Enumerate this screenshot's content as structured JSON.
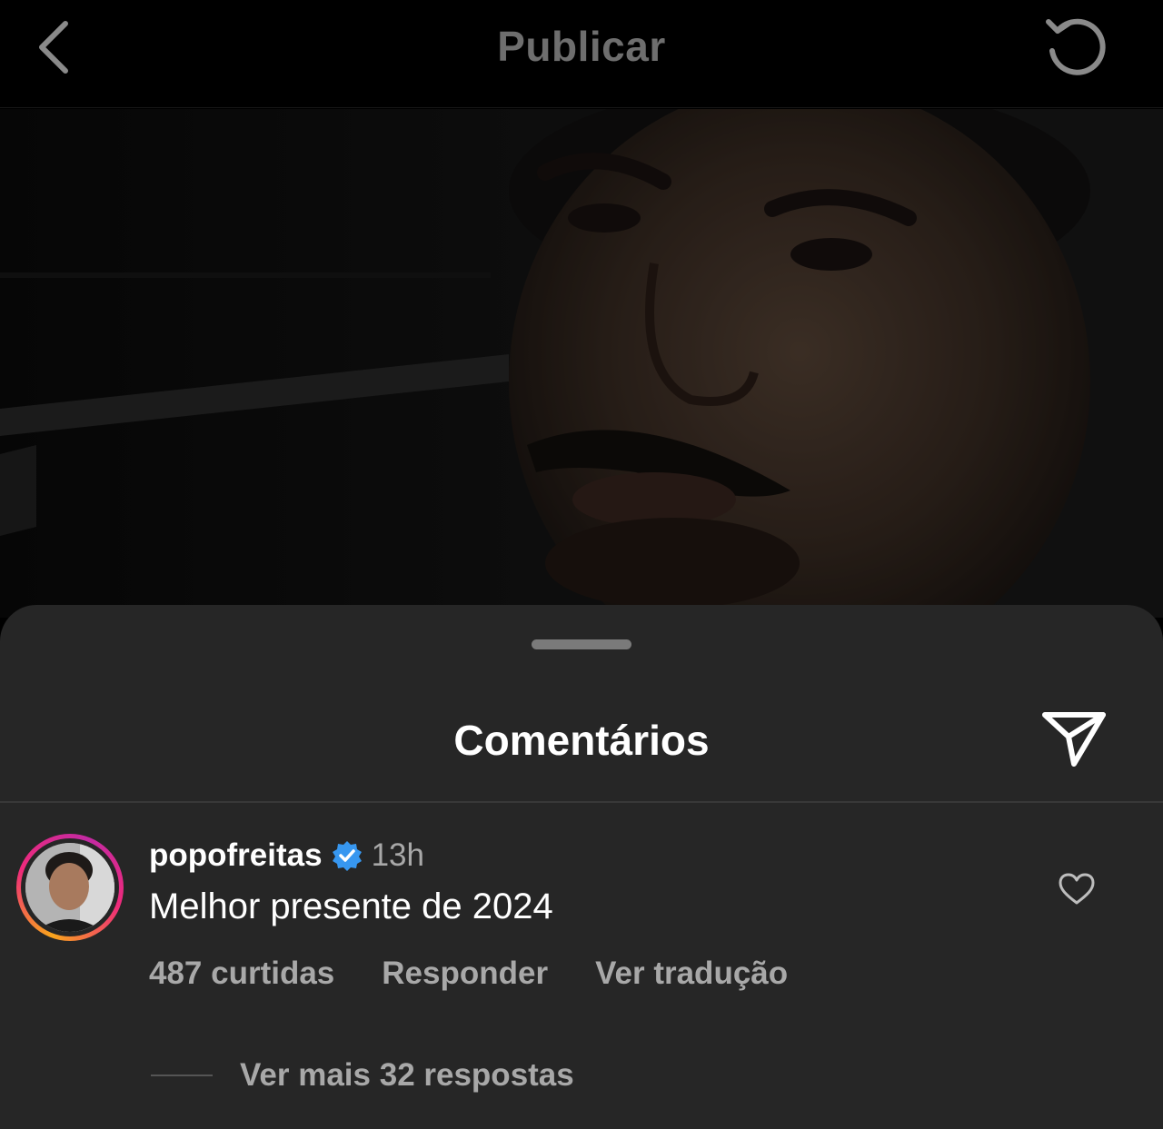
{
  "header": {
    "title": "Publicar",
    "back_icon": "chevron-left-icon",
    "refresh_icon": "refresh-icon"
  },
  "post": {
    "image_description_icon": "photo"
  },
  "comments_sheet": {
    "title": "Comentários",
    "share_icon": "send-icon",
    "comment": {
      "username": "popofreitas",
      "verified": true,
      "time": "13h",
      "text": "Melhor presente de 2024",
      "likes": "487 curtidas",
      "reply_label": "Responder",
      "translate_label": "Ver tradução",
      "more_replies": "Ver mais 32 respostas"
    }
  },
  "colors": {
    "background": "#000000",
    "sheet": "#262626",
    "verified_badge": "#3797f0",
    "muted_text": "#a8a8a8",
    "header_title": "#6e6e6e"
  }
}
